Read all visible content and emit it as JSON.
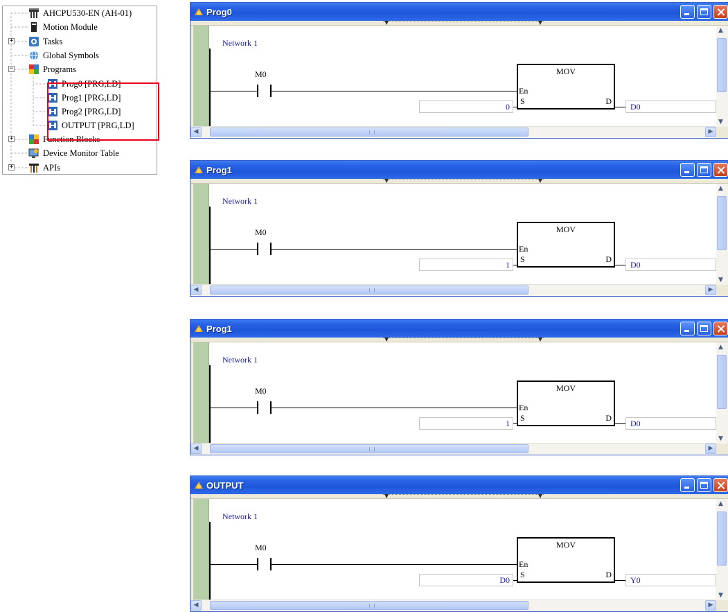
{
  "tree": {
    "items": [
      {
        "label": "AHCPU530-EN  (AH-01)",
        "icon": "cpu-icon"
      },
      {
        "label": "Motion Module",
        "icon": "module-icon"
      },
      {
        "label": "Tasks",
        "icon": "tasks-icon",
        "expander": "+"
      },
      {
        "label": "Global Symbols",
        "icon": "globe-icon"
      },
      {
        "label": "Programs",
        "icon": "programs-icon",
        "expander": "-"
      },
      {
        "label": "Prog0 [PRG,LD]",
        "icon": "program-file-icon"
      },
      {
        "label": "Prog1 [PRG,LD]",
        "icon": "program-file-icon"
      },
      {
        "label": "Prog2 [PRG,LD]",
        "icon": "program-file-icon"
      },
      {
        "label": "OUTPUT [PRG,LD]",
        "icon": "program-file-icon"
      },
      {
        "label": "Function Blocks",
        "icon": "function-blocks-icon",
        "expander": "+"
      },
      {
        "label": "Device Monitor Table",
        "icon": "monitor-table-icon"
      },
      {
        "label": "APIs",
        "icon": "apis-icon",
        "expander": "+"
      }
    ]
  },
  "windows": [
    {
      "title": "Prog0",
      "network": "Network 1",
      "contact": "M0",
      "function": "MOV",
      "pin_en": "En",
      "pin_s": "S",
      "pin_d": "D",
      "source": "0",
      "dest": "D0"
    },
    {
      "title": "Prog1",
      "network": "Network 1",
      "contact": "M0",
      "function": "MOV",
      "pin_en": "En",
      "pin_s": "S",
      "pin_d": "D",
      "source": "1",
      "dest": "D0"
    },
    {
      "title": "Prog1",
      "network": "Network 1",
      "contact": "M0",
      "function": "MOV",
      "pin_en": "En",
      "pin_s": "S",
      "pin_d": "D",
      "source": "1",
      "dest": "D0"
    },
    {
      "title": "OUTPUT",
      "network": "Network 1",
      "contact": "M0",
      "function": "MOV",
      "pin_en": "En",
      "pin_s": "S",
      "pin_d": "D",
      "source": "D0",
      "dest": "Y0"
    }
  ],
  "colors": {
    "titlebar": "#2a63e6",
    "highlight": "#e8001c",
    "operand": "#1a1aa8"
  }
}
